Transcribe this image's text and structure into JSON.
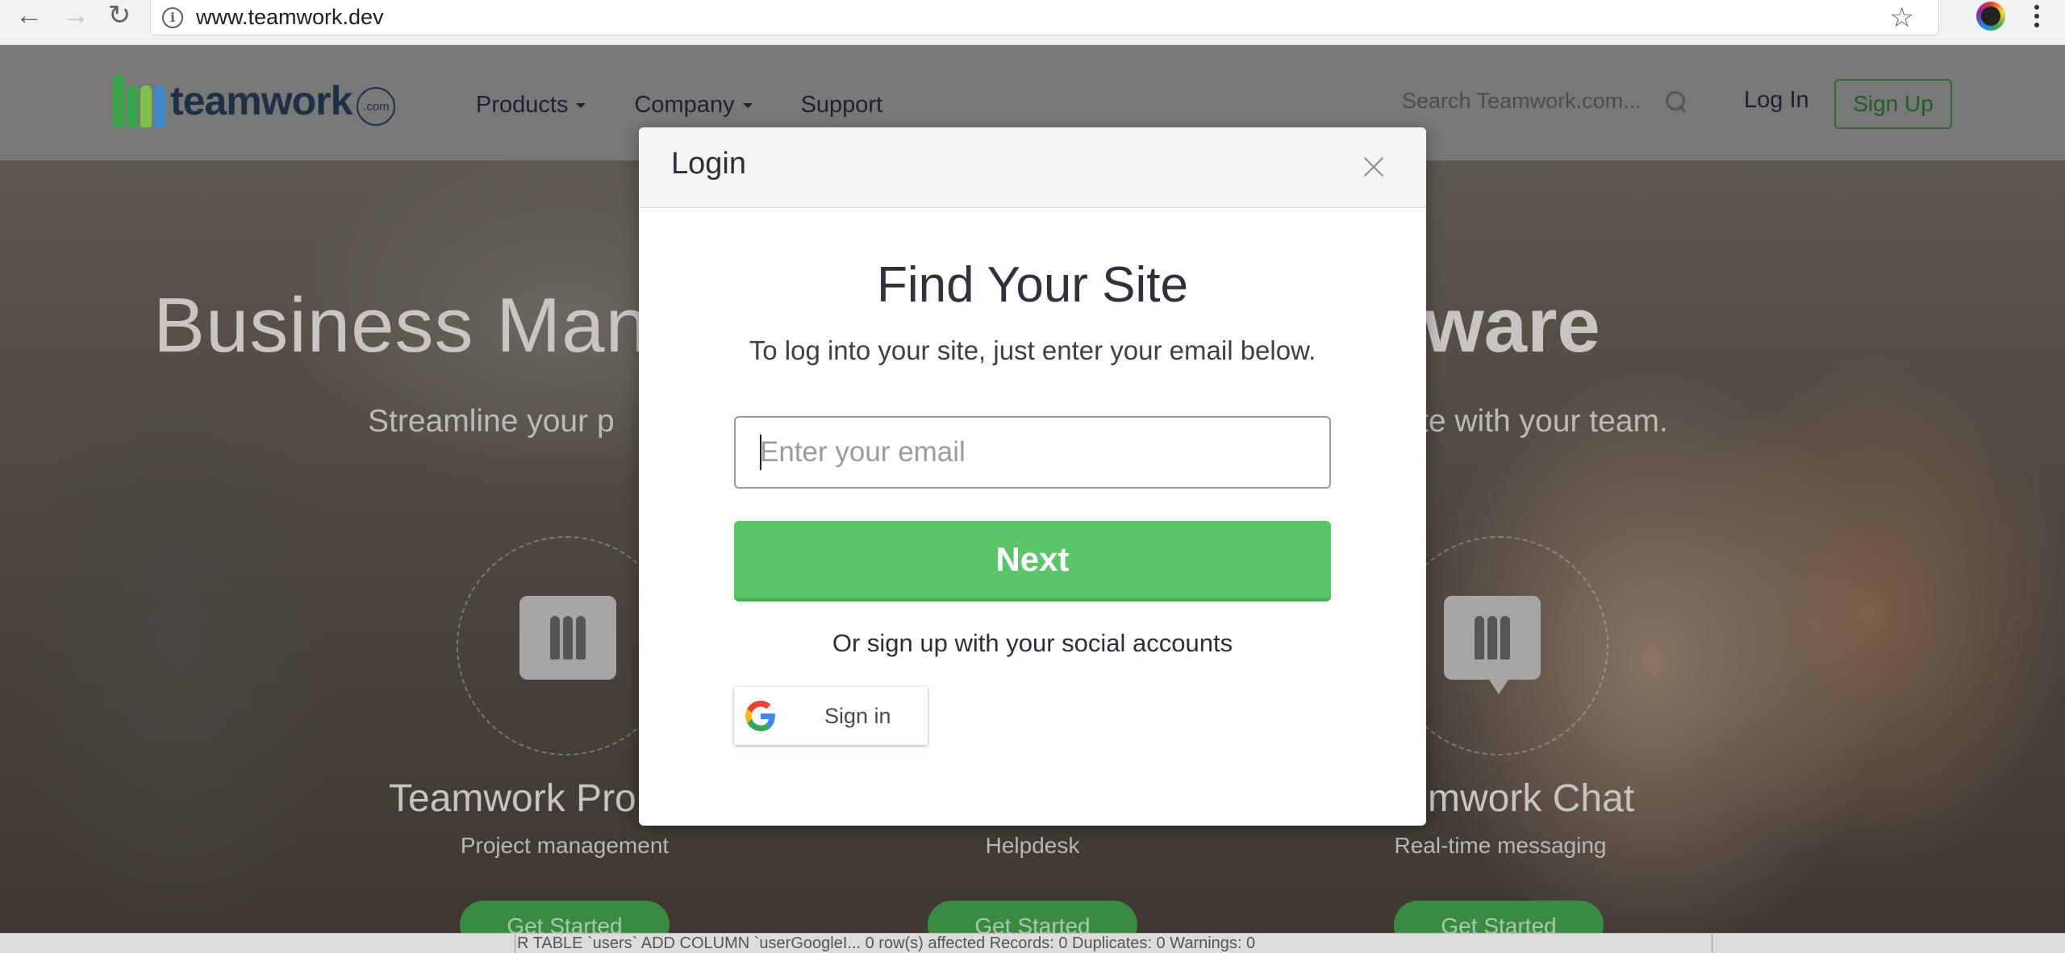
{
  "browser": {
    "url": "www.teamwork.dev",
    "back_icon": "←",
    "forward_icon": "→",
    "reload_icon": "↻",
    "info_icon": "i",
    "star_icon": "☆"
  },
  "header": {
    "logo_text": "teamwork",
    "logo_suffix": ".com",
    "nav": {
      "products": "Products",
      "company": "Company",
      "support": "Support"
    },
    "search_placeholder": "Search Teamwork.com...",
    "login": "Log In",
    "signup": "Sign Up",
    "logo_colors": [
      "#3aa548",
      "#3aa548",
      "#7fc04a",
      "#3b87c7"
    ]
  },
  "hero": {
    "title_start": "Business Man",
    "title_end": "ware",
    "subtitle_start": "Streamline your p",
    "subtitle_end": "te with your team.",
    "products": [
      {
        "title": "Teamwork Pro",
        "subtitle": "Project management",
        "cta": "Get Started"
      },
      {
        "title": "",
        "subtitle": "Helpdesk",
        "cta": "Get Started"
      },
      {
        "title": "mwork Chat",
        "subtitle": "Real-time messaging",
        "cta": "Get Started"
      }
    ]
  },
  "status_strip": {
    "text": "R TABLE `users` ADD COLUMN `userGoogleI...   0 row(s) affected Records: 0  Duplicates: 0  Warnings: 0"
  },
  "modal": {
    "title": "Login",
    "heading": "Find Your Site",
    "subheading": "To log into your site, just enter your email below.",
    "email_placeholder": "Enter your email",
    "email_value": "",
    "next_label": "Next",
    "social_text": "Or sign up with your social accounts",
    "google_label": "Sign in",
    "accent_color": "#5cc569"
  }
}
